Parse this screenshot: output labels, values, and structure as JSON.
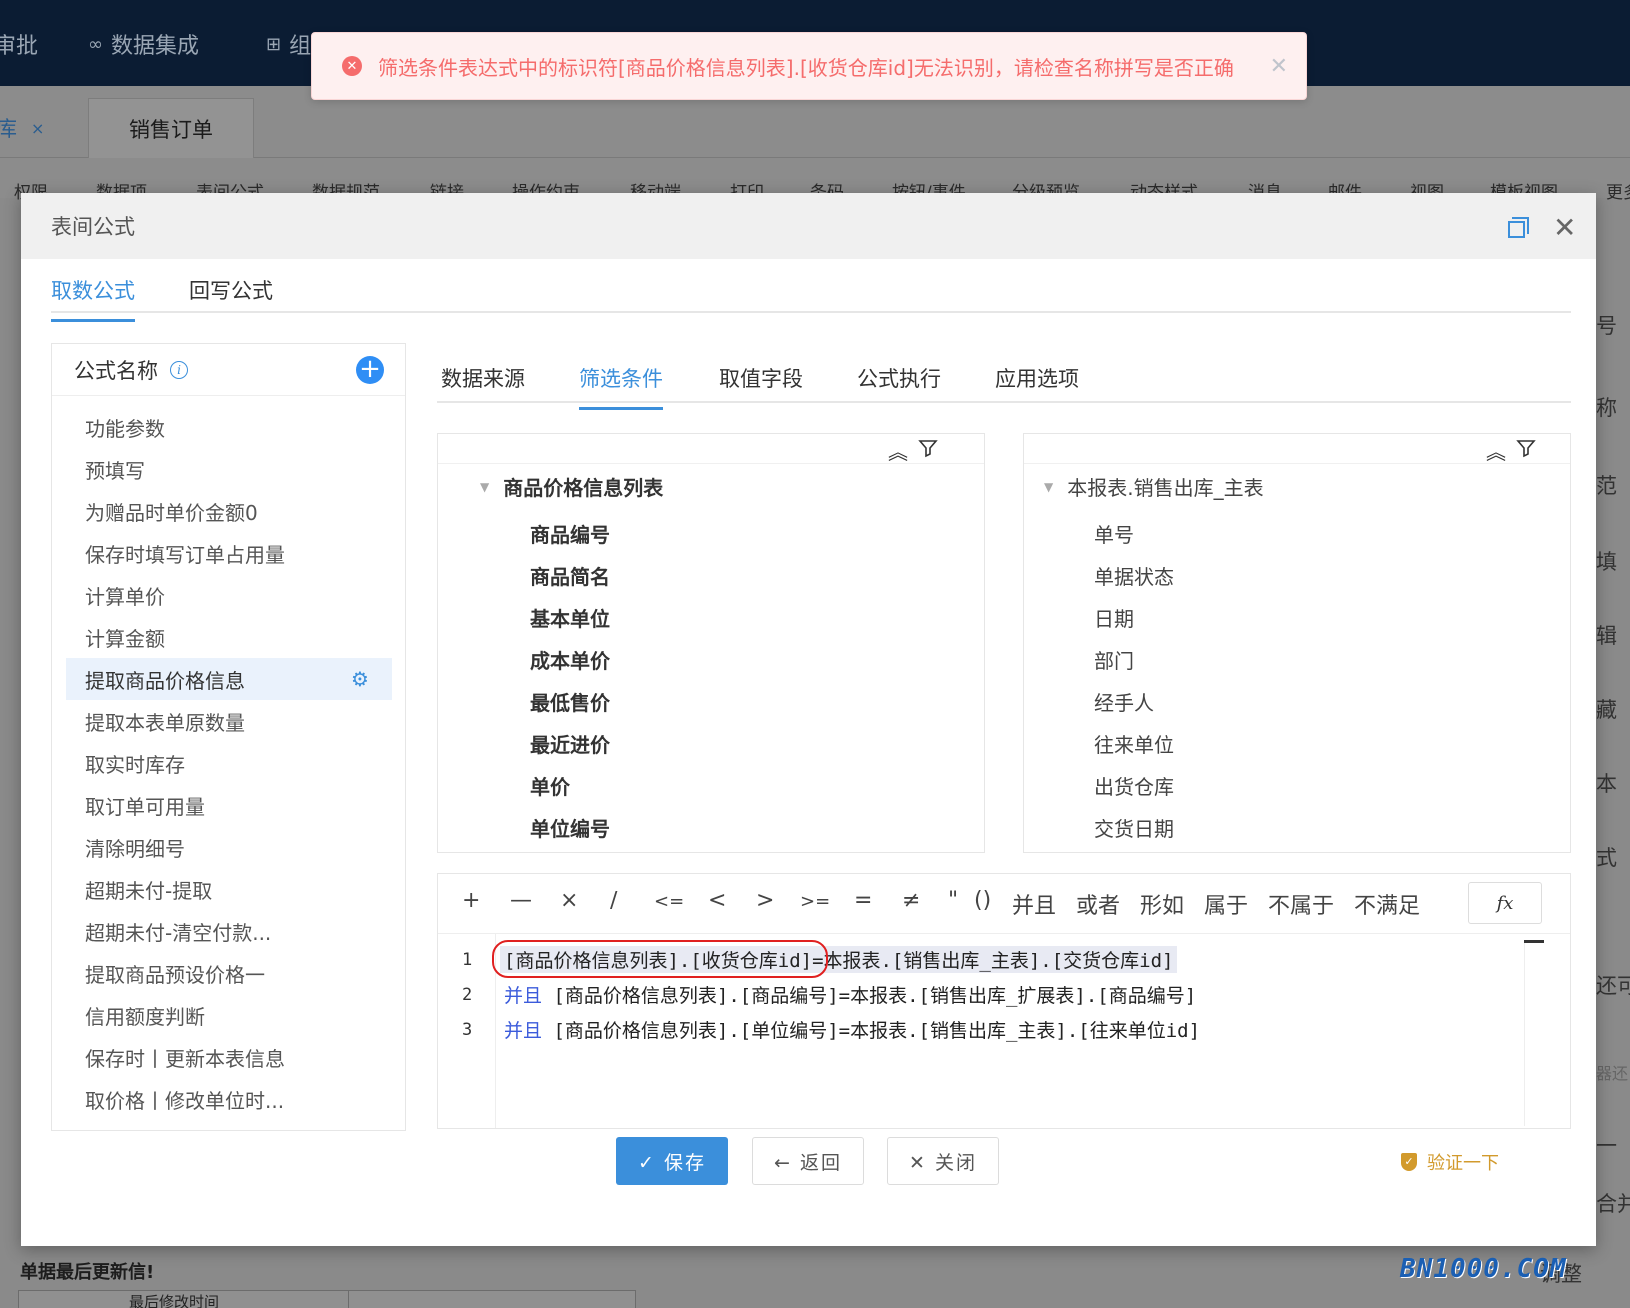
{
  "topbar": {
    "nav_items": [
      {
        "label": "审批",
        "icon": ""
      },
      {
        "label": "数据集成",
        "icon": "cloud-link-icon"
      },
      {
        "label": "组",
        "icon": "org-tree-icon"
      }
    ]
  },
  "doc_tabs": [
    {
      "label": "库"
    },
    {
      "label": "销售订单"
    }
  ],
  "toolbar_items": [
    "权限",
    "数据项",
    "表间公式",
    "数据规范",
    "链接",
    "操作约束",
    "移动端",
    "打印",
    "条码",
    "按钮/事件",
    "分级预览",
    "动态样式",
    "消息",
    "邮件",
    "视图",
    "模板视图",
    "更多"
  ],
  "right_side_labels": [
    "号",
    "称",
    "范",
    "填",
    "辑",
    "藏",
    "本",
    "式",
    "还可",
    "器还",
    "一",
    "合并",
    "调整"
  ],
  "alert": {
    "message": "筛选条件表达式中的标识符[商品价格信息列表].[收货仓库id]无法识别，请检查名称拼写是否正确"
  },
  "dialog": {
    "title": "表间公式",
    "main_tabs": [
      "取数公式",
      "回写公式"
    ],
    "formula_panel": {
      "header": "公式名称",
      "items": [
        "功能参数",
        "预填写",
        "为赠品时单价金额0",
        "保存时填写订单占用量",
        "计算单价",
        "计算金额",
        "提取商品价格信息",
        "提取本表单原数量",
        "取实时库存",
        "取订单可用量",
        "清除明细号",
        "超期未付-提取",
        "超期未付-清空付款...",
        "提取商品预设价格一",
        "信用额度判断",
        "保存时丨更新本表信息",
        "取价格丨修改单位时..."
      ],
      "active_index": 6
    },
    "sub_tabs": [
      "数据来源",
      "筛选条件",
      "取值字段",
      "公式执行",
      "应用选项"
    ],
    "active_sub_tab": 1,
    "left_tree": {
      "root": "商品价格信息列表",
      "children": [
        "商品编号",
        "商品简名",
        "基本单位",
        "成本单价",
        "最低售价",
        "最近进价",
        "单价",
        "单位编号"
      ]
    },
    "right_tree": {
      "root": "本报表.销售出库_主表",
      "children": [
        "单号",
        "单据状态",
        "日期",
        "部门",
        "经手人",
        "往来单位",
        "出货仓库",
        "交货日期"
      ]
    },
    "operators": [
      "+",
      "—",
      "×",
      "∕",
      "<=",
      "<",
      ">",
      ">=",
      "=",
      "≠",
      "\"",
      "()",
      "并且",
      "或者",
      "形如",
      "属于",
      "不属于",
      "不满足"
    ],
    "fx_label": "fx",
    "code_lines": [
      {
        "num": "1",
        "keyword": "",
        "text": "[商品价格信息列表].[收货仓库id]=本报表.[销售出库_主表].[交货仓库id]"
      },
      {
        "num": "2",
        "keyword": "并且",
        "text": " [商品价格信息列表].[商品编号]=本报表.[销售出库_扩展表].[商品编号]"
      },
      {
        "num": "3",
        "keyword": "并且",
        "text": " [商品价格信息列表].[单位编号]=本报表.[销售出库_主表].[往来单位id]"
      }
    ],
    "buttons": {
      "save": "✓ 保存",
      "back": "← 返回",
      "close": "✕ 关闭",
      "verify": "验证一下"
    }
  },
  "background": {
    "bottom_label": "单据最后更新信!",
    "bottom_table_header": "最后修改时间"
  },
  "watermark": "BN1000.COM",
  "colors": {
    "accent": "#3b8fdb",
    "error": "#f56c6c",
    "verify": "#d29a2c",
    "topbar": "#0b1c33"
  }
}
